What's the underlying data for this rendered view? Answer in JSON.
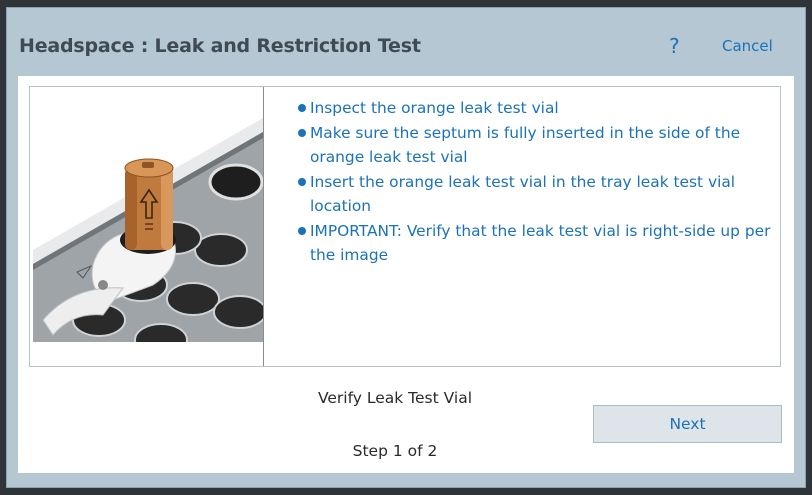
{
  "dialog": {
    "title": "Headspace : Leak and Restriction Test",
    "help_label": "?",
    "cancel_label": "Cancel"
  },
  "panel": {
    "image": {
      "description_icon": "leak-test-vial-tray-image"
    },
    "instructions": [
      "Inspect the orange leak test vial",
      "Make sure the septum is fully inserted in the side of the orange leak test vial",
      "Insert the orange leak test vial in the tray leak test vial location",
      "IMPORTANT: Verify that the leak test vial is right-side up per the image"
    ]
  },
  "step": {
    "title": "Verify Leak Test Vial",
    "counter": "Step 1 of 2",
    "next_label": "Next"
  },
  "colors": {
    "accent": "#1b72b8",
    "frame": "#b5c7d3",
    "vial": "#c17a3d"
  }
}
